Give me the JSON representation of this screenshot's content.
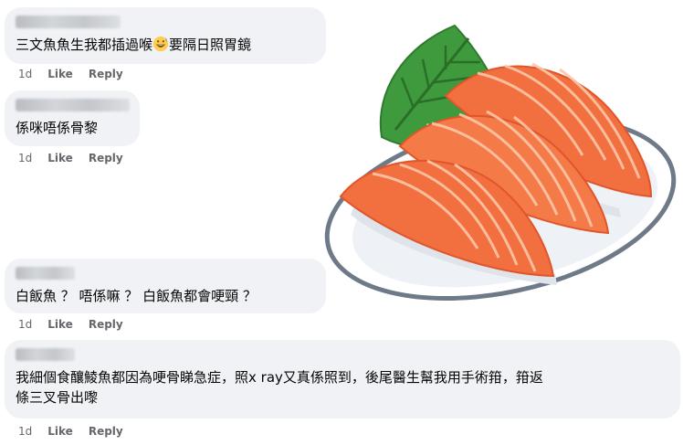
{
  "comments": [
    {
      "text": "三文魚魚生我都插過喉",
      "text_after": "要隔日照胃鏡",
      "emoji": "grinning-sweat-face",
      "time": "1d",
      "like": "Like",
      "reply": "Reply"
    },
    {
      "text": "係咪唔係骨黎",
      "time": "1d",
      "like": "Like",
      "reply": "Reply"
    },
    {
      "text": "白飯魚 ？ 唔係嘛 ？ 白飯魚都會哽頸 ？",
      "time": "1d",
      "like": "Like",
      "reply": "Reply"
    },
    {
      "text": "我細個食釀鯪魚都因為哽骨睇急症，照x ray又真係照到，後尾醫生幫我用手術箝，箝返\n條三叉骨出嚟",
      "time": "1d",
      "like": "Like",
      "reply": "Reply"
    }
  ],
  "image": {
    "subject": "salmon-sashimi-illustration"
  },
  "colors": {
    "bubble": "#f0f2f5",
    "meta": "#65676b",
    "text": "#050505",
    "salmon": "#f26f3f",
    "leaf": "#3e9a3c"
  }
}
